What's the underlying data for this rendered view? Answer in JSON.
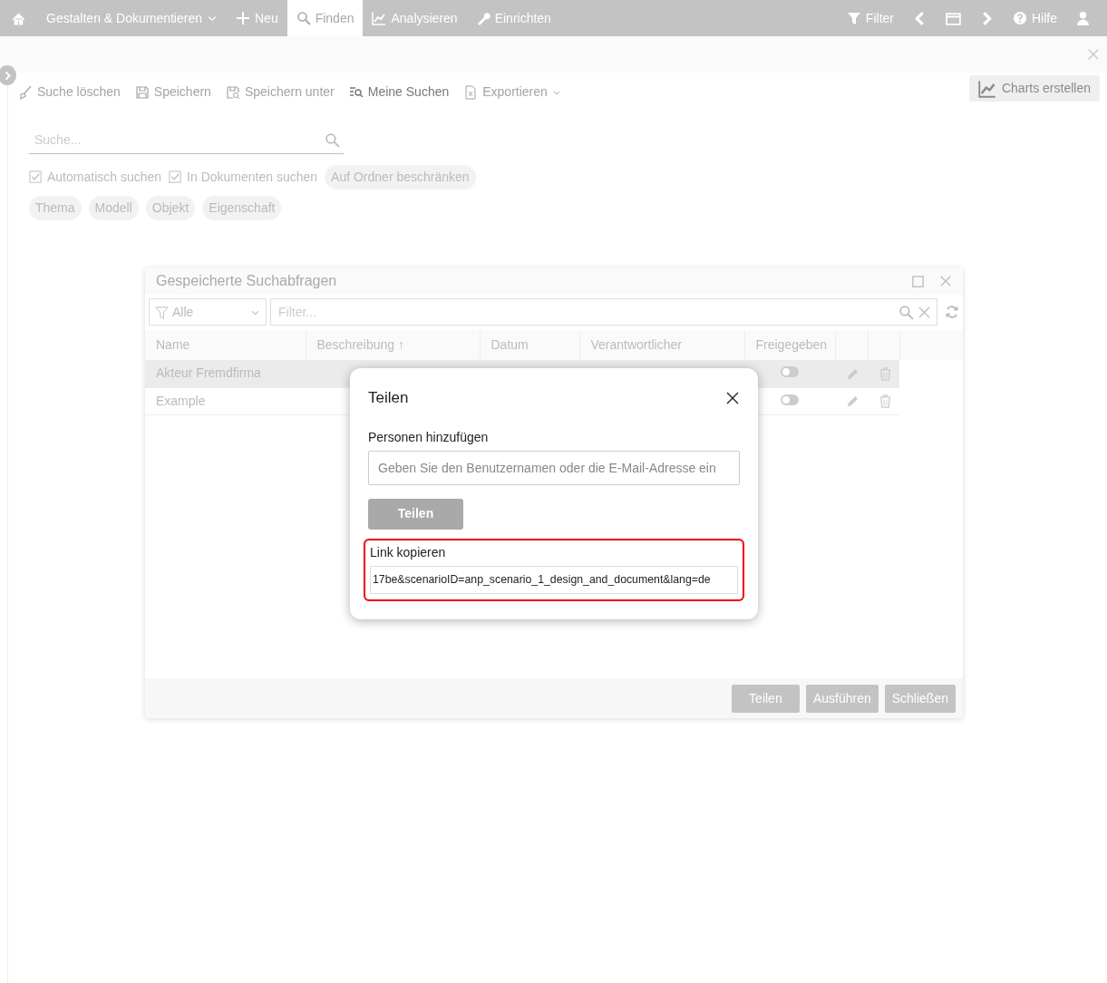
{
  "navbar": {
    "left": [
      {
        "kind": "dropdown",
        "label": "Gestalten & Dokumentieren",
        "selected": false
      },
      {
        "kind": "link",
        "label": "Neu",
        "selected": false
      },
      {
        "kind": "link",
        "label": "Finden",
        "selected": true
      },
      {
        "kind": "link",
        "label": "Analysieren",
        "selected": false
      },
      {
        "kind": "link",
        "label": "Einrichten",
        "selected": false
      }
    ],
    "right": [
      {
        "kind": "labeled",
        "label": "Filter"
      },
      {
        "kind": "icon"
      },
      {
        "kind": "icon"
      },
      {
        "kind": "icon"
      },
      {
        "kind": "labeled",
        "label": "Hilfe"
      },
      {
        "kind": "icon"
      }
    ]
  },
  "toolbar": [
    {
      "label": "Suche löschen",
      "disabled": true,
      "dropdown": false
    },
    {
      "label": "Speichern",
      "disabled": true,
      "dropdown": false
    },
    {
      "label": "Speichern unter",
      "disabled": true,
      "dropdown": false
    },
    {
      "label": "Meine Suchen",
      "disabled": false,
      "dropdown": false
    },
    {
      "label": "Exportieren",
      "disabled": true,
      "dropdown": true
    }
  ],
  "charts_button": {
    "label": "Charts erstellen",
    "disabled": true
  },
  "search": {
    "placeholder": "Suche..."
  },
  "options": [
    {
      "kind": "checkbox",
      "label": "Automatisch suchen",
      "checked": true
    },
    {
      "kind": "checkbox",
      "label": "In Dokumenten suchen",
      "checked": true
    },
    {
      "kind": "chip",
      "label": "Auf Ordner beschränken"
    }
  ],
  "chips": [
    "Thema",
    "Modell",
    "Objekt",
    "Eigenschaft"
  ],
  "saved_searches": {
    "title": "Gespeicherte Suchabfragen",
    "filter_select": "Alle",
    "filter_placeholder": "Filter...",
    "columns": [
      "Name",
      "Beschreibung ↑",
      "Datum",
      "Verantwortlicher",
      "Freigegeben"
    ],
    "rows": [
      {
        "name": "Akteur Fremdfirma",
        "shared": false,
        "selected": true
      },
      {
        "name": "Example",
        "shared": false,
        "selected": false
      }
    ],
    "buttons": [
      "Teilen",
      "Ausführen",
      "Schließen"
    ]
  },
  "share_dialog": {
    "title": "Teilen",
    "people_label": "Personen hinzufügen",
    "people_placeholder": "Geben Sie den Benutzernamen oder die E-Mail-Adresse ein",
    "share_button": {
      "label": "Teilen",
      "disabled": true
    },
    "link_label": "Link kopieren",
    "link_value": "17be&scenarioID=anp_scenario_1_design_and_document&lang=de",
    "link_highlighted": true
  }
}
